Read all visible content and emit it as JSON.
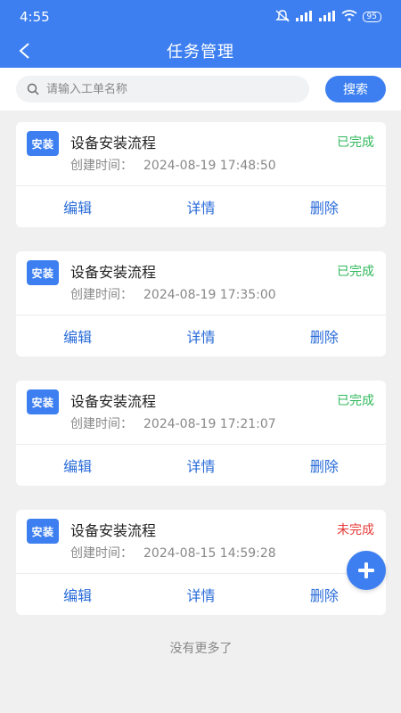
{
  "status_bar": {
    "time": "4:55",
    "battery": "95"
  },
  "nav": {
    "title": "任务管理"
  },
  "search": {
    "placeholder": "请输入工单名称",
    "button_label": "搜索"
  },
  "tasks": [
    {
      "badge": "安装",
      "title": "设备安装流程",
      "time_label": "创建时间：",
      "time": "2024-08-19 17:48:50",
      "status": "已完成",
      "status_color": "#2fb85a"
    },
    {
      "badge": "安装",
      "title": "设备安装流程",
      "time_label": "创建时间：",
      "time": "2024-08-19 17:35:00",
      "status": "已完成",
      "status_color": "#2fb85a"
    },
    {
      "badge": "安装",
      "title": "设备安装流程",
      "time_label": "创建时间：",
      "time": "2024-08-19 17:21:07",
      "status": "已完成",
      "status_color": "#2fb85a"
    },
    {
      "badge": "安装",
      "title": "设备安装流程",
      "time_label": "创建时间：",
      "time": "2024-08-15 14:59:28",
      "status": "未完成",
      "status_color": "#e53935"
    }
  ],
  "actions": {
    "edit": "编辑",
    "detail": "详情",
    "delete": "删除"
  },
  "footer": {
    "no_more": "没有更多了"
  },
  "colors": {
    "accent": "#3d7ff0",
    "done": "#2fb85a",
    "undone": "#e53935"
  }
}
